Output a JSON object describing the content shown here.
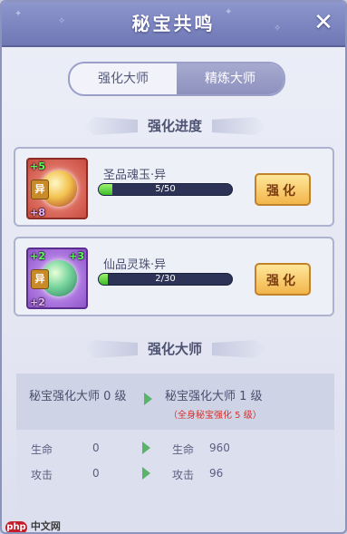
{
  "window": {
    "title": "秘宝共鸣"
  },
  "tabs": [
    {
      "label": "强化大师",
      "active": false
    },
    {
      "label": "精炼大师",
      "active": true
    }
  ],
  "progress_section": {
    "title": "强化进度"
  },
  "items": [
    {
      "name": "圣品魂玉·异",
      "badge": "异",
      "level_tl": "+5",
      "level_bl": "+8",
      "progress_text": "5/50",
      "progress_fraction": 0.1,
      "button_label": "强化",
      "icon": "soul-jade-icon"
    },
    {
      "name": "仙品灵珠·异",
      "badge": "异",
      "level_tl": "+2",
      "level_tr": "+3",
      "level_bl": "+2",
      "progress_text": "2/30",
      "progress_fraction": 0.07,
      "button_label": "强化",
      "icon": "spirit-pearl-icon"
    }
  ],
  "master_section": {
    "title": "强化大师",
    "current_level": "秘宝强化大师 0 级",
    "next_level": "秘宝强化大师 1 级",
    "requirement": "（全身秘宝强化 5 级）",
    "stats": [
      {
        "label": "生命",
        "current": "0",
        "next_label": "生命",
        "next": "960"
      },
      {
        "label": "攻击",
        "current": "0",
        "next_label": "攻击",
        "next": "96"
      }
    ]
  },
  "watermark": {
    "badge": "php",
    "text": "中文网"
  },
  "colors": {
    "title_bar": "#7f88c2",
    "button": "#f2b54a",
    "progress": "#3dbb2a",
    "requirement": "#d4312a"
  }
}
